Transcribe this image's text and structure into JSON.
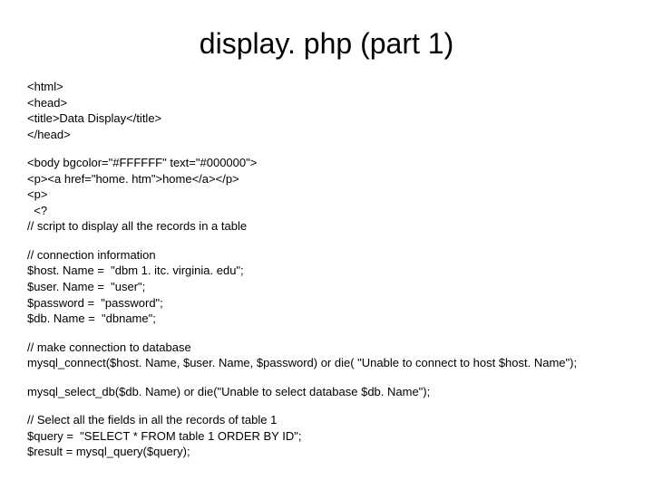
{
  "title": "display. php (part 1)",
  "block1": "<html>\n<head>\n<title>Data Display</title>\n</head>",
  "block2": "<body bgcolor=\"#FFFFFF\" text=\"#000000\">\n<p><a href=\"home. htm\">home</a></p>\n<p>\n  <?\n// script to display all the records in a table",
  "block3": "// connection information\n$host. Name =  \"dbm 1. itc. virginia. edu\";\n$user. Name =  \"user\";\n$password =  \"password\";\n$db. Name =  \"dbname\";",
  "block4": "// make connection to database\nmysql_connect($host. Name, $user. Name, $password) or die( \"Unable to connect to host $host. Name\");",
  "block5": "mysql_select_db($db. Name) or die(\"Unable to select database $db. Name\");",
  "block6": "// Select all the fields in all the records of table 1\n$query =  \"SELECT * FROM table 1 ORDER BY ID\";\n$result = mysql_query($query);"
}
